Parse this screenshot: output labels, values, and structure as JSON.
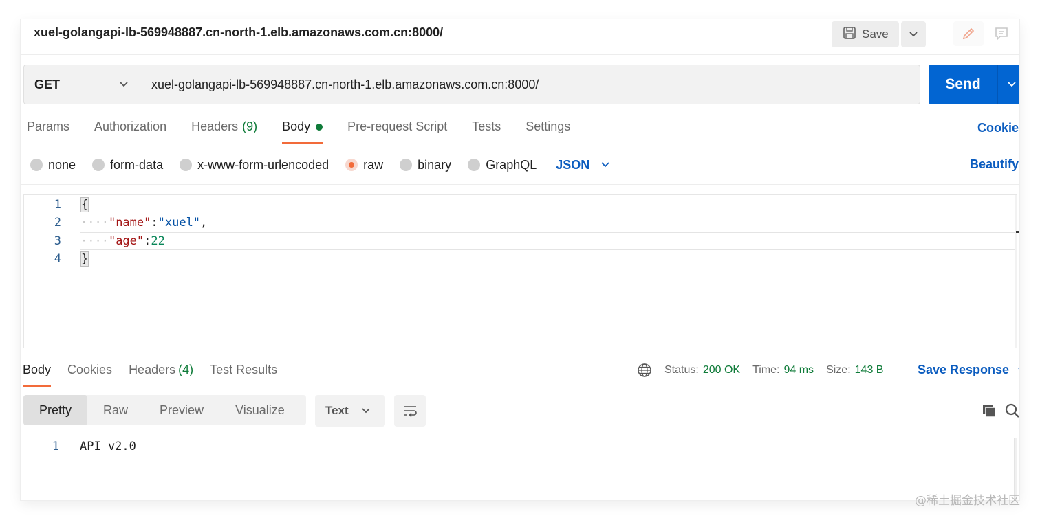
{
  "title_bar": {
    "request_name": "xuel-golangapi-lb-569948887.cn-north-1.elb.amazonaws.com.cn:8000/",
    "save_label": "Save",
    "icons": [
      "save-icon",
      "chevron-down-icon",
      "pencil-icon",
      "comment-icon"
    ]
  },
  "request": {
    "method": "GET",
    "url": "xuel-golangapi-lb-569948887.cn-north-1.elb.amazonaws.com.cn:8000/",
    "send_label": "Send",
    "tabs": [
      {
        "label": "Params"
      },
      {
        "label": "Authorization"
      },
      {
        "label": "Headers",
        "count": "(9)"
      },
      {
        "label": "Body"
      },
      {
        "label": "Pre-request Script"
      },
      {
        "label": "Tests"
      },
      {
        "label": "Settings"
      }
    ],
    "active_tab": "Body",
    "cookies_label": "Cookies",
    "body_types": [
      "none",
      "form-data",
      "x-www-form-urlencoded",
      "raw",
      "binary",
      "GraphQL"
    ],
    "selected_body_type": "raw",
    "language": "JSON",
    "beautify_label": "Beautify",
    "editor": {
      "line_numbers": [
        "1",
        "2",
        "3",
        "4"
      ],
      "open_brace": "{",
      "close_brace": "}",
      "name_key": "\"name\"",
      "name_value": "\"xuel\"",
      "age_key": "\"age\"",
      "age_value": "22",
      "colon": ":",
      "comma": ",",
      "indent": "····"
    }
  },
  "response": {
    "tabs": [
      {
        "label": "Body"
      },
      {
        "label": "Cookies"
      },
      {
        "label": "Headers",
        "count": "(4)"
      },
      {
        "label": "Test Results"
      }
    ],
    "active_tab": "Body",
    "status_label": "Status:",
    "status_value": "200 OK",
    "time_label": "Time:",
    "time_value": "94 ms",
    "size_label": "Size:",
    "size_value": "143 B",
    "save_response_label": "Save Response",
    "views": [
      "Pretty",
      "Raw",
      "Preview",
      "Visualize"
    ],
    "active_view": "Pretty",
    "format": "Text",
    "body_line_number": "1",
    "body_text": "API v2.0"
  },
  "watermark": "@稀土掘金技术社区",
  "colors": {
    "accent": "#f26b3a",
    "primary_blue": "#0265d2",
    "link_blue": "#0b5cbf",
    "success_green": "#0f7b39"
  }
}
